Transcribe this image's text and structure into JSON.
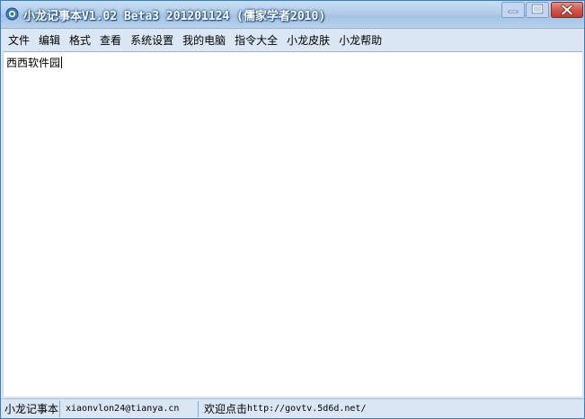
{
  "window": {
    "title": "小龙记事本V1.02 Beta3 201201124 (儒家学者2010)"
  },
  "menu": {
    "items": [
      {
        "label": "文件"
      },
      {
        "label": "编辑"
      },
      {
        "label": "格式"
      },
      {
        "label": "查看"
      },
      {
        "label": "系统设置"
      },
      {
        "label": "我的电脑"
      },
      {
        "label": "指令大全"
      },
      {
        "label": "小龙皮肤"
      },
      {
        "label": "小龙帮助"
      }
    ]
  },
  "editor": {
    "content": "西西软件园"
  },
  "statusbar": {
    "app_name": "小龙记事本",
    "email": "xiaonvlon24@tianya.cn",
    "promo_prefix": "欢迎点击",
    "promo_url": "http://govtv.5d6d.net/"
  },
  "icons": {
    "app": "notepad-app-icon",
    "minimize": "minimize-icon",
    "maximize": "maximize-icon",
    "close": "close-icon"
  },
  "colors": {
    "title_gradient_top": "#c9ddf2",
    "close_button": "#c9463d",
    "menubar": "#dbe7f5"
  }
}
